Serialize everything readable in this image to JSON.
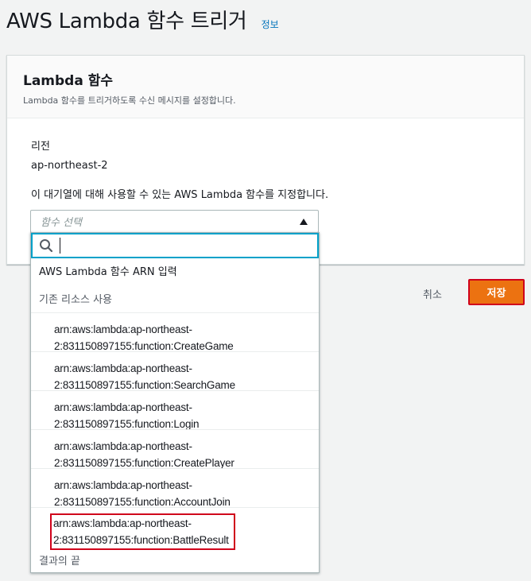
{
  "header": {
    "title": "AWS Lambda 함수 트리거",
    "info_link": "정보"
  },
  "container": {
    "title": "Lambda 함수",
    "description": "Lambda 함수를 트리거하도록 수신 메시지를 설정합니다.",
    "region_label": "리전",
    "region_value": "ap-northeast-2",
    "function_label": "이 대기열에 대해 사용할 수 있는 AWS Lambda 함수를 지정합니다."
  },
  "select": {
    "placeholder": "함수 선택",
    "search_value": ""
  },
  "dropdown": {
    "arn_option": "AWS Lambda 함수 ARN 입력",
    "group_label": "기존 리소스 사용",
    "items": [
      {
        "line1": "arn:aws:lambda:ap-northeast-",
        "line2": "2:831150897155:function:CreateGame"
      },
      {
        "line1": "arn:aws:lambda:ap-northeast-",
        "line2": "2:831150897155:function:SearchGame"
      },
      {
        "line1": "arn:aws:lambda:ap-northeast-",
        "line2": "2:831150897155:function:Login"
      },
      {
        "line1": "arn:aws:lambda:ap-northeast-",
        "line2": "2:831150897155:function:CreatePlayer"
      },
      {
        "line1": "arn:aws:lambda:ap-northeast-",
        "line2": "2:831150897155:function:AccountJoin"
      },
      {
        "line1": "arn:aws:lambda:ap-northeast-",
        "line2": "2:831150897155:function:BattleResult",
        "highlighted": true
      }
    ],
    "end_label": "결과의 끝"
  },
  "actions": {
    "cancel_label": "취소",
    "save_label": "저장"
  },
  "colors": {
    "accent": "#00a1c9",
    "primary_button": "#ec7211",
    "highlight_border": "#d0021b",
    "link": "#0073bb"
  }
}
